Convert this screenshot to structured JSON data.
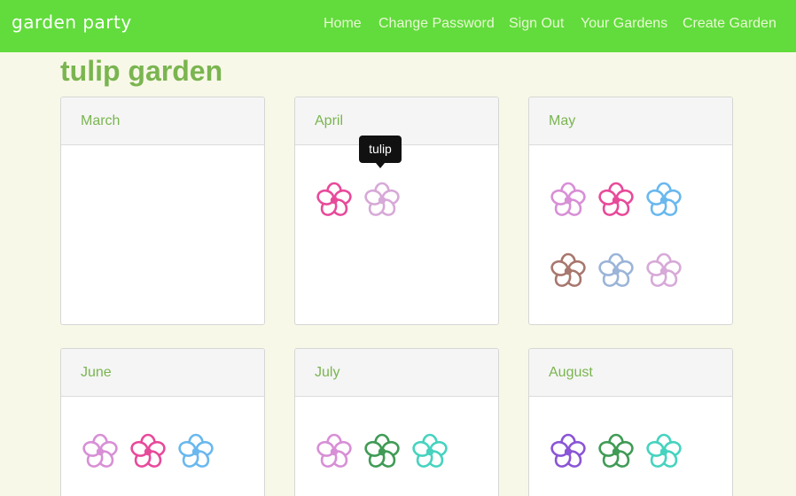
{
  "navbar": {
    "brand": "garden party",
    "links": [
      "Home",
      "Change Password",
      "Sign Out",
      "Your Gardens",
      "Create Garden"
    ]
  },
  "page": {
    "title": "tulip garden"
  },
  "tooltip": {
    "text": "tulip"
  },
  "months": [
    {
      "name": "March",
      "flowers": []
    },
    {
      "name": "April",
      "flowers": [
        {
          "name": "tulip",
          "color": "#e84a9a"
        },
        {
          "name": "tulip",
          "color": "#d7a9d8"
        }
      ]
    },
    {
      "name": "May",
      "flowers": [
        {
          "color": "#d88fd6"
        },
        {
          "color": "#e84a9a"
        },
        {
          "color": "#6ab8ee"
        },
        {
          "color": "#a8776e"
        },
        {
          "color": "#9bb4d8"
        },
        {
          "color": "#d7a9d8"
        }
      ]
    },
    {
      "name": "June",
      "flowers": [
        {
          "color": "#d88fd6"
        },
        {
          "color": "#e84a9a"
        },
        {
          "color": "#6ab8ee"
        }
      ]
    },
    {
      "name": "July",
      "flowers": [
        {
          "color": "#d88fd6"
        },
        {
          "color": "#3f9b55"
        },
        {
          "color": "#46d3bf"
        }
      ]
    },
    {
      "name": "August",
      "flowers": [
        {
          "color": "#8a55d6"
        },
        {
          "color": "#3f9b55"
        },
        {
          "color": "#46d3bf"
        }
      ]
    }
  ]
}
